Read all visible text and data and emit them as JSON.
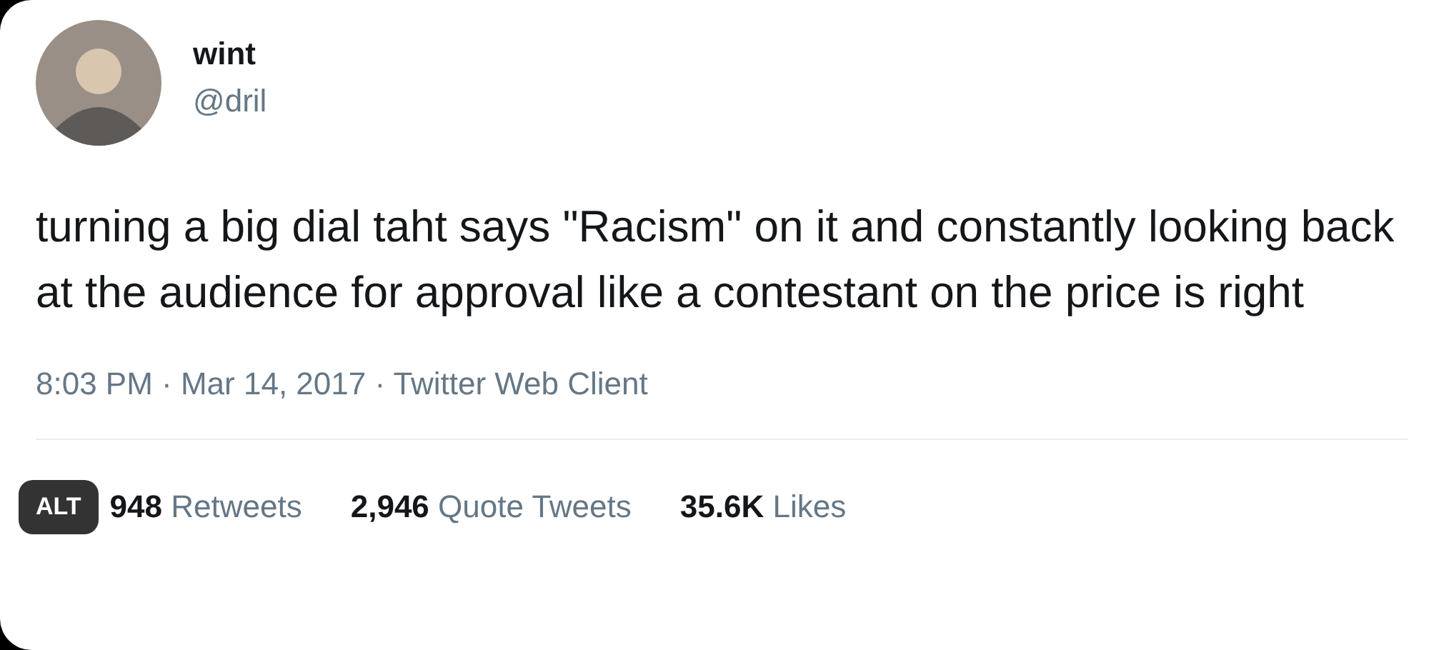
{
  "author": {
    "name": "wint",
    "handle": "@dril"
  },
  "text": "turning a big dial taht says \"Racism\" on it and constantly looking back at the audience for approval like a contestant on the price is right",
  "meta": "8:03 PM · Mar 14, 2017 · Twitter Web Client",
  "stats": [
    {
      "count": "948",
      "label": "Retweets"
    },
    {
      "count": "2,946",
      "label": "Quote Tweets"
    },
    {
      "count": "35.6K",
      "label": "Likes"
    }
  ],
  "alt_badge": "ALT"
}
